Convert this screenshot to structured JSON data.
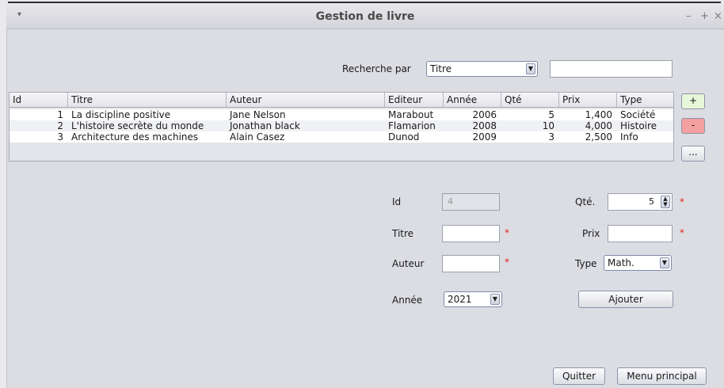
{
  "window": {
    "title": "Gestion de livre",
    "controls": {
      "menu": "▾",
      "minimize": "–",
      "maximize": "+",
      "close": "×"
    }
  },
  "search": {
    "label": "Recherche par",
    "selected": "Titre",
    "value": ""
  },
  "table": {
    "columns": [
      "Id",
      "Titre",
      "Auteur",
      "Editeur",
      "Année",
      "Qté",
      "Prix",
      "Type"
    ],
    "rows": [
      [
        "1",
        "La discipline positive",
        "Jane Nelson",
        "Marabout",
        "2006",
        "5",
        "1,400",
        "Société"
      ],
      [
        "2",
        "L'histoire secrète du monde",
        "Jonathan black",
        "Flamarion",
        "2008",
        "10",
        "4,000",
        "Histoire"
      ],
      [
        "3",
        "Architecture des machines",
        "Alain Casez",
        "Dunod",
        "2009",
        "3",
        "2,500",
        "Info"
      ]
    ]
  },
  "side_buttons": {
    "add": "+",
    "remove": "-",
    "more": "..."
  },
  "form": {
    "id_label": "Id",
    "id_value": "4",
    "titre_label": "Titre",
    "titre_value": "",
    "auteur_label": "Auteur",
    "auteur_value": "",
    "annee_label": "Année",
    "annee_value": "2021",
    "qte_label": "Qté.",
    "qte_value": "5",
    "prix_label": "Prix",
    "prix_value": "",
    "type_label": "Type",
    "type_value": "Math.",
    "required_mark": "*",
    "ajouter_label": "Ajouter"
  },
  "footer": {
    "quit_label": "Quitter",
    "menu_label": "Menu principal"
  },
  "colors": {
    "add_button": "#e6f7d9",
    "remove_button": "#f4a0a0",
    "required": "#e0281e"
  }
}
